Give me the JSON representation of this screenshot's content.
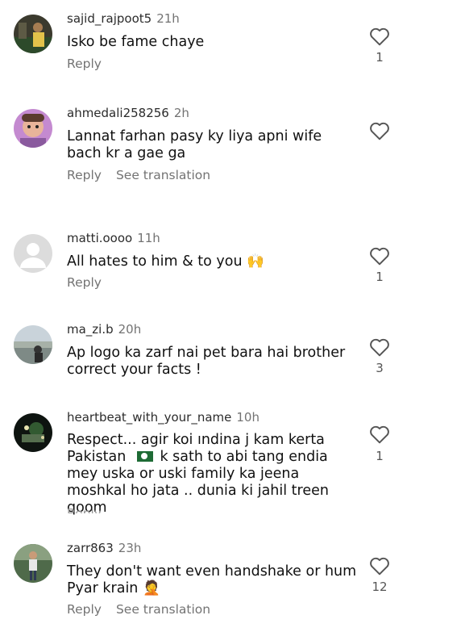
{
  "comments": [
    {
      "username": "sajid_rajpoot5",
      "time": "21h",
      "text": "Isko be fame chaye",
      "actions": [
        "Reply"
      ],
      "likes": "1"
    },
    {
      "username": "ahmedali258256",
      "time": "2h",
      "text": "Lannat farhan pasy ky liya apni wife bach kr a gae ga",
      "actions": [
        "Reply",
        "See translation"
      ],
      "likes": ""
    },
    {
      "username": "matti.oooo",
      "time": "11h",
      "text": "All hates to him & to you 🙌",
      "actions": [
        "Reply"
      ],
      "likes": "1"
    },
    {
      "username": "ma_zi.b",
      "time": "20h",
      "text": "Ap logo ka zarf nai pet bara hai brother correct your facts !",
      "actions": [
        "Reply"
      ],
      "likes": "3"
    },
    {
      "username": "heartbeat_with_your_name",
      "time": "10h",
      "text_before_flag": "Respect... agir koi ındina j kam kerta Pakistan",
      "text_after_flag": "k sath to abi tang endia mey uska or uski family ka jeena moshkal ho jata .. dunia ki jahil treen qoom",
      "actions": [
        "Reply"
      ],
      "likes": "1"
    },
    {
      "username": "zarr863",
      "time": "23h",
      "text": "They don't want even handshake or hum Pyar krain 🤦",
      "actions": [
        "Reply",
        "See translation"
      ],
      "likes": "12"
    }
  ]
}
